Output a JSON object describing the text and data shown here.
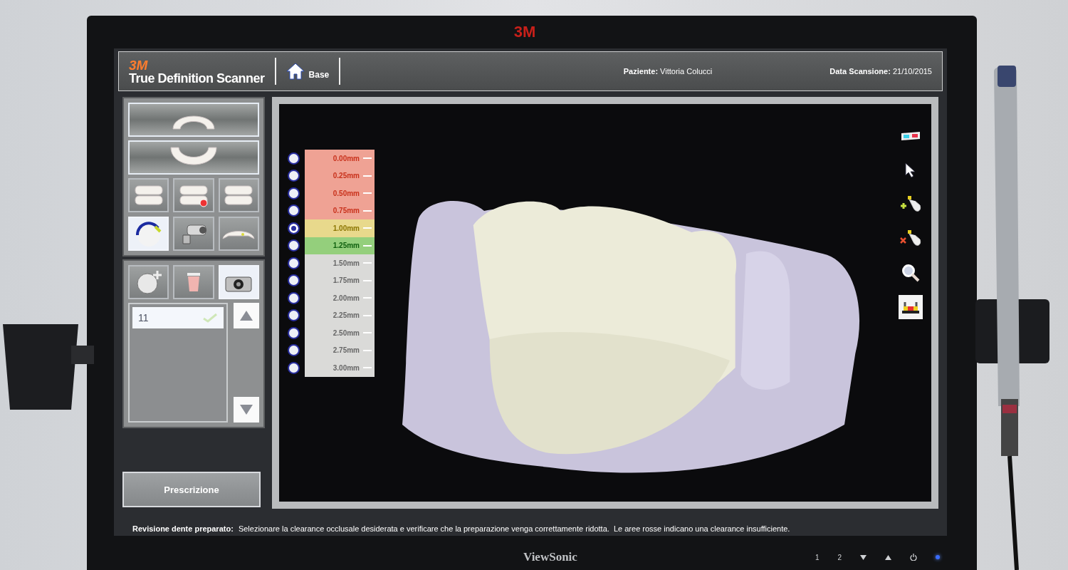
{
  "monitor": {
    "brand_top": "3M",
    "brand_bottom": "ViewSonic",
    "buttons": [
      "1",
      "2"
    ]
  },
  "header": {
    "logo": "3M",
    "app_title": "True Definition Scanner",
    "home": "Base",
    "patient": "**Paziente:** Vittoria Colucci",
    "scan_date": "**Data Scansione:** 21/10/2015"
  },
  "arch_tools": [
    {
      "kind": "upper-arch",
      "selected": false
    },
    {
      "kind": "lower-arch",
      "selected": false
    }
  ],
  "tools": [
    {
      "kind": "bite-left",
      "selected": false
    },
    {
      "kind": "bite-front",
      "selected": false
    },
    {
      "kind": "bite-right",
      "selected": false
    },
    {
      "kind": "clearance",
      "selected": true
    },
    {
      "kind": "video",
      "selected": false
    },
    {
      "kind": "prep",
      "selected": false
    }
  ],
  "scan_actions": [
    {
      "kind": "add-scan",
      "selected": false
    },
    {
      "kind": "delete",
      "selected": false
    },
    {
      "kind": "camera",
      "selected": true
    }
  ],
  "scan_list": [
    {
      "label": "11",
      "checked": true,
      "selected": true
    }
  ],
  "prescription_button": "Prescrizione",
  "clearance_scale": [
    {
      "label": "0.00mm",
      "color": "#efa294",
      "kind": "insufficient",
      "selected": false
    },
    {
      "label": "0.25mm",
      "color": "#efa294",
      "kind": "insufficient",
      "selected": false
    },
    {
      "label": "0.50mm",
      "color": "#efa294",
      "kind": "insufficient",
      "selected": false
    },
    {
      "label": "0.75mm",
      "color": "#efa294",
      "kind": "insufficient",
      "selected": false
    },
    {
      "label": "1.00mm",
      "color": "#e8d98c",
      "kind": "warning",
      "selected": true
    },
    {
      "label": "1.25mm",
      "color": "#94cf7c",
      "kind": "ok",
      "selected": false
    },
    {
      "label": "1.50mm",
      "color": "#dadad8",
      "kind": "neutral",
      "selected": false
    },
    {
      "label": "1.75mm",
      "color": "#dadad8",
      "kind": "neutral",
      "selected": false
    },
    {
      "label": "2.00mm",
      "color": "#dadad8",
      "kind": "neutral",
      "selected": false
    },
    {
      "label": "2.25mm",
      "color": "#dadad8",
      "kind": "neutral",
      "selected": false
    },
    {
      "label": "2.50mm",
      "color": "#dadad8",
      "kind": "neutral",
      "selected": false
    },
    {
      "label": "2.75mm",
      "color": "#dadad8",
      "kind": "neutral",
      "selected": false
    },
    {
      "label": "3.00mm",
      "color": "#dadad8",
      "kind": "neutral",
      "selected": false
    }
  ],
  "view_tools": [
    {
      "kind": "glasses",
      "selected": false
    },
    {
      "kind": "pointer",
      "selected": false
    },
    {
      "kind": "add-point",
      "selected": false
    },
    {
      "kind": "remove-point",
      "selected": false
    },
    {
      "kind": "zoom",
      "selected": false
    },
    {
      "kind": "preview",
      "selected": true
    }
  ],
  "status_bar": "**Revisione dente preparato:** Selezionare la clearance occlusale desiderata e verificare che la preparazione venga correttamente ridotta.  Le aree rosse indicano una clearance insufficiente."
}
